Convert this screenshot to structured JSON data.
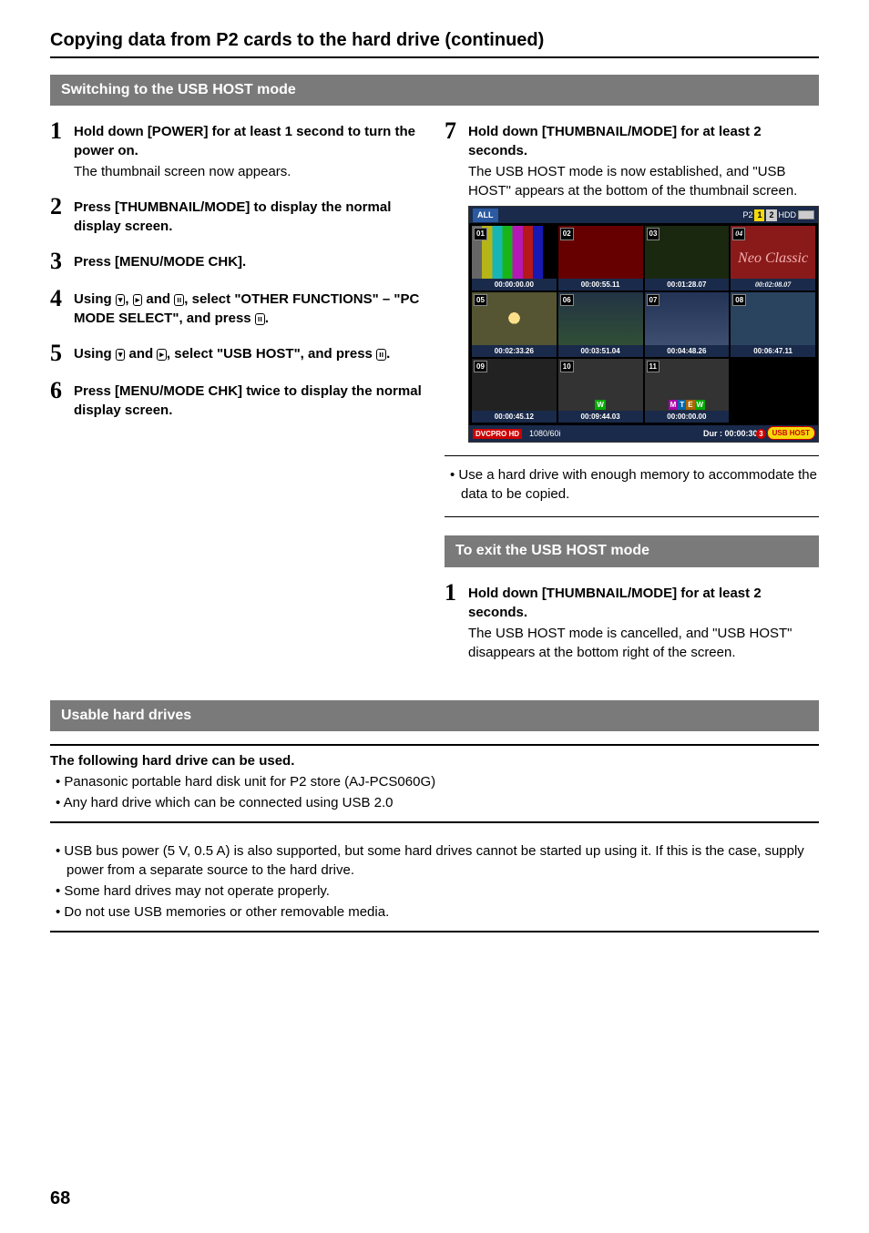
{
  "page_title": "Copying data from P2 cards to the hard drive (continued)",
  "section1_title": "Switching to the USB HOST mode",
  "steps_left": [
    {
      "n": "1",
      "bold": "Hold down [POWER] for at least 1 second to turn the power on.",
      "desc": "The thumbnail screen now appears."
    },
    {
      "n": "2",
      "bold": "Press [THUMBNAIL/MODE] to display the normal display screen.",
      "desc": ""
    },
    {
      "n": "3",
      "bold": "Press [MENU/MODE CHK].",
      "desc": ""
    },
    {
      "n": "4",
      "bold_pre": "Using ",
      "icon1": "▾",
      "mid1": ", ",
      "icon2": "▸",
      "mid2": " and ",
      "icon3": "ıı",
      "bold_post": ", select \"OTHER FUNCTIONS\" – \"PC MODE SELECT\", and press ",
      "icon4": "ıı",
      "bold_end": ".",
      "desc": ""
    },
    {
      "n": "5",
      "bold_pre": "Using ",
      "icon1": "▾",
      "mid1": " and ",
      "icon2": "▸",
      "bold_post": ", select \"USB HOST\", and press ",
      "icon3": "ıı",
      "bold_end": ".",
      "desc": ""
    },
    {
      "n": "6",
      "bold": "Press [MENU/MODE CHK] twice to display the normal display screen.",
      "desc": ""
    }
  ],
  "steps_right": [
    {
      "n": "7",
      "bold": "Hold down [THUMBNAIL/MODE] for at least 2 seconds.",
      "desc": "The USB HOST mode is now established, and \"USB HOST\" appears at the bottom of the thumbnail screen."
    }
  ],
  "right_note": "Use a hard drive with enough memory to accommodate the data to be copied.",
  "subsection_title": "To exit the USB HOST mode",
  "exit_steps": [
    {
      "n": "1",
      "bold": "Hold down [THUMBNAIL/MODE] for at least 2 seconds.",
      "desc": "The USB HOST mode is cancelled, and \"USB HOST\" disappears at the bottom right of the screen."
    }
  ],
  "usable_title": "Usable hard drives",
  "usable_header": "The following hard drive can be used.",
  "usable_list": [
    "Panasonic portable hard disk unit for P2 store (AJ-PCS060G)",
    "Any hard drive which can be connected using USB 2.0"
  ],
  "usable_notes": [
    "USB bus power (5 V, 0.5 A) is also supported, but some hard drives cannot be started up using it. If this is the case, supply power from a separate source to the hard drive.",
    "Some hard drives may not operate properly.",
    "Do not use USB memories or other removable media."
  ],
  "screenshot": {
    "top_all": "ALL",
    "p2_label": "P2",
    "slot1": "1",
    "slot2": "2",
    "hdd_label": "HDD",
    "cells": [
      {
        "num": "01",
        "tc": "00:00:00.00",
        "cls": "bars"
      },
      {
        "num": "02",
        "tc": "00:00:55.11",
        "cls": "red"
      },
      {
        "num": "03",
        "tc": "00:01:28.07",
        "cls": "dark"
      },
      {
        "num": "04",
        "tc": "00:02:08.07",
        "cls": "script",
        "text": "Neo Classic"
      },
      {
        "num": "05",
        "tc": "00:02:33.26",
        "cls": "sun"
      },
      {
        "num": "06",
        "tc": "00:03:51.04",
        "cls": "green"
      },
      {
        "num": "07",
        "tc": "00:04:48.26",
        "cls": "blue"
      },
      {
        "num": "08",
        "tc": "00:06:47.11",
        "cls": "blue2"
      },
      {
        "num": "09",
        "tc": "00:00:45.12",
        "cls": "camera"
      },
      {
        "num": "10",
        "tc": "00:09:44.03",
        "cls": "flower",
        "marks": [
          "W"
        ]
      },
      {
        "num": "11",
        "tc": "00:00:00.00",
        "cls": "flower",
        "marks": [
          "M",
          "T",
          "E",
          "W"
        ]
      },
      {
        "num": "",
        "tc": "",
        "cls": "black"
      }
    ],
    "bottom_dvc": "DVCPRO HD",
    "bottom_format": "1080/60i",
    "bottom_dur": "Dur : 00:00:30.",
    "bottom_bubble": "3",
    "bottom_usb": "USB HOST"
  },
  "page_number": "68"
}
